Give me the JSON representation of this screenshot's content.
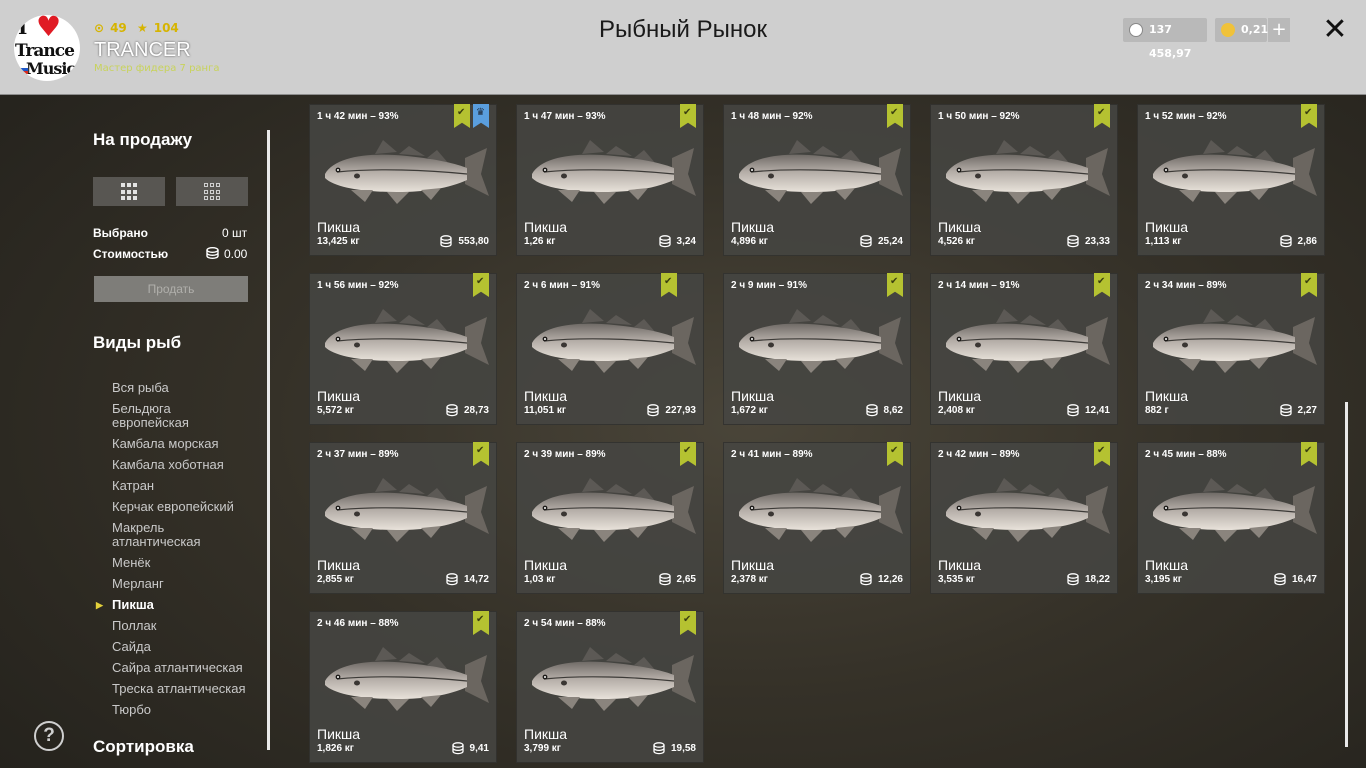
{
  "header": {
    "title": "Рыбный Рынок",
    "logo": {
      "line1": "I",
      "line2": "Trance",
      "line3": "Music"
    },
    "level": "49",
    "stars": "104",
    "username": "TRANCER",
    "rank": "Мастер фидера 7 ранга",
    "silver": "137 458,97",
    "gold": "0,21",
    "plus_label": "+",
    "close_label": "✕"
  },
  "sidebar": {
    "for_sale": "На продажу",
    "selected_label": "Выбрано",
    "selected_value": "0 шт",
    "cost_label": "Стоимостью",
    "cost_value": "0.00",
    "sell_button": "Продать",
    "species_heading": "Виды рыб",
    "species": [
      "Вся рыба",
      "Бельдюга\nевропейская",
      "Камбала морская",
      "Камбала хоботная",
      "Катран",
      "Керчак европейский",
      "Макрель\nатлантическая",
      "Менёк",
      "Мерланг",
      "Пикша",
      "Поллак",
      "Сайда",
      "Сайра атлантическая",
      "Треска атлантическая",
      "Тюрбо"
    ],
    "selected_species_index": 9,
    "sort_heading": "Сортировка",
    "help_label": "?"
  },
  "colors": {
    "accent_green": "#b5c231",
    "badge_blue": "#5a9ede",
    "badge_gold": "#e2b52b",
    "gold_coin": "#f0c23a"
  },
  "cards": [
    {
      "time": "1 ч 42 мин – 93%",
      "name": "Пикша",
      "weight": "13,425 кг",
      "price": "553,80",
      "badges": [
        "green",
        "blue"
      ]
    },
    {
      "time": "1 ч 47 мин – 93%",
      "name": "Пикша",
      "weight": "1,26 кг",
      "price": "3,24",
      "badges": [
        "green"
      ]
    },
    {
      "time": "1 ч 48 мин – 92%",
      "name": "Пикша",
      "weight": "4,896 кг",
      "price": "25,24",
      "badges": [
        "green"
      ]
    },
    {
      "time": "1 ч 50 мин – 92%",
      "name": "Пикша",
      "weight": "4,526 кг",
      "price": "23,33",
      "badges": [
        "green"
      ]
    },
    {
      "time": "1 ч 52 мин – 92%",
      "name": "Пикша",
      "weight": "1,113 кг",
      "price": "2,86",
      "badges": [
        "green"
      ]
    },
    {
      "time": "1 ч 56 мин – 92%",
      "name": "Пикша",
      "weight": "5,572 кг",
      "price": "28,73",
      "badges": [
        "green"
      ]
    },
    {
      "time": "2 ч 6 мин – 91%",
      "name": "Пикша",
      "weight": "11,051 кг",
      "price": "227,93",
      "badges": [
        "green",
        "gold"
      ]
    },
    {
      "time": "2 ч 9 мин – 91%",
      "name": "Пикша",
      "weight": "1,672 кг",
      "price": "8,62",
      "badges": [
        "green"
      ]
    },
    {
      "time": "2 ч 14 мин – 91%",
      "name": "Пикша",
      "weight": "2,408 кг",
      "price": "12,41",
      "badges": [
        "green"
      ]
    },
    {
      "time": "2 ч 34 мин – 89%",
      "name": "Пикша",
      "weight": "882 г",
      "price": "2,27",
      "badges": [
        "green"
      ]
    },
    {
      "time": "2 ч 37 мин – 89%",
      "name": "Пикша",
      "weight": "2,855 кг",
      "price": "14,72",
      "badges": [
        "green"
      ]
    },
    {
      "time": "2 ч 39 мин – 89%",
      "name": "Пикша",
      "weight": "1,03 кг",
      "price": "2,65",
      "badges": [
        "green"
      ]
    },
    {
      "time": "2 ч 41 мин – 89%",
      "name": "Пикша",
      "weight": "2,378 кг",
      "price": "12,26",
      "badges": [
        "green"
      ]
    },
    {
      "time": "2 ч 42 мин – 89%",
      "name": "Пикша",
      "weight": "3,535 кг",
      "price": "18,22",
      "badges": [
        "green"
      ]
    },
    {
      "time": "2 ч 45 мин – 88%",
      "name": "Пикша",
      "weight": "3,195 кг",
      "price": "16,47",
      "badges": [
        "green"
      ]
    },
    {
      "time": "2 ч 46 мин – 88%",
      "name": "Пикша",
      "weight": "1,826 кг",
      "price": "9,41",
      "badges": [
        "green"
      ]
    },
    {
      "time": "2 ч 54 мин – 88%",
      "name": "Пикша",
      "weight": "3,799 кг",
      "price": "19,58",
      "badges": [
        "green"
      ]
    }
  ]
}
